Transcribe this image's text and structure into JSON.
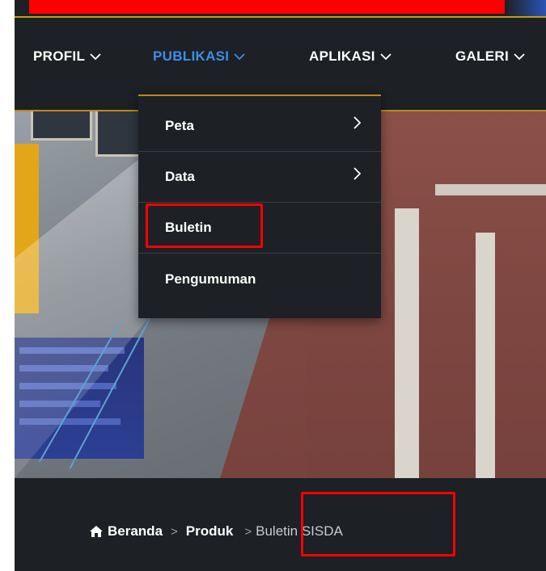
{
  "colors": {
    "nav_bg": "#1d2024",
    "active": "#3b8fe8",
    "text": "#ffffff",
    "accent_gold": "#b88c18",
    "annotation": "#ff0000"
  },
  "nav": {
    "items": [
      {
        "label": "PROFIL",
        "active": false,
        "icon": "chevron-down-icon"
      },
      {
        "label": "PUBLIKASI",
        "active": true,
        "icon": "chevron-down-icon"
      },
      {
        "label": "APLIKASI",
        "active": false,
        "icon": "chevron-down-icon"
      },
      {
        "label": "GALERI",
        "active": false,
        "icon": "chevron-down-icon"
      }
    ]
  },
  "dropdown": {
    "items": [
      {
        "label": "Peta",
        "has_submenu": true,
        "icon": "chevron-right-icon"
      },
      {
        "label": "Data",
        "has_submenu": true,
        "icon": "chevron-right-icon"
      },
      {
        "label": "Buletin",
        "has_submenu": false
      },
      {
        "label": "Pengumuman",
        "has_submenu": false
      }
    ]
  },
  "breadcrumb": {
    "home_icon": "home-icon",
    "items": [
      {
        "label": "Beranda"
      },
      {
        "label": "Produk"
      }
    ],
    "separator": ">",
    "current": "Buletin SISDA"
  }
}
